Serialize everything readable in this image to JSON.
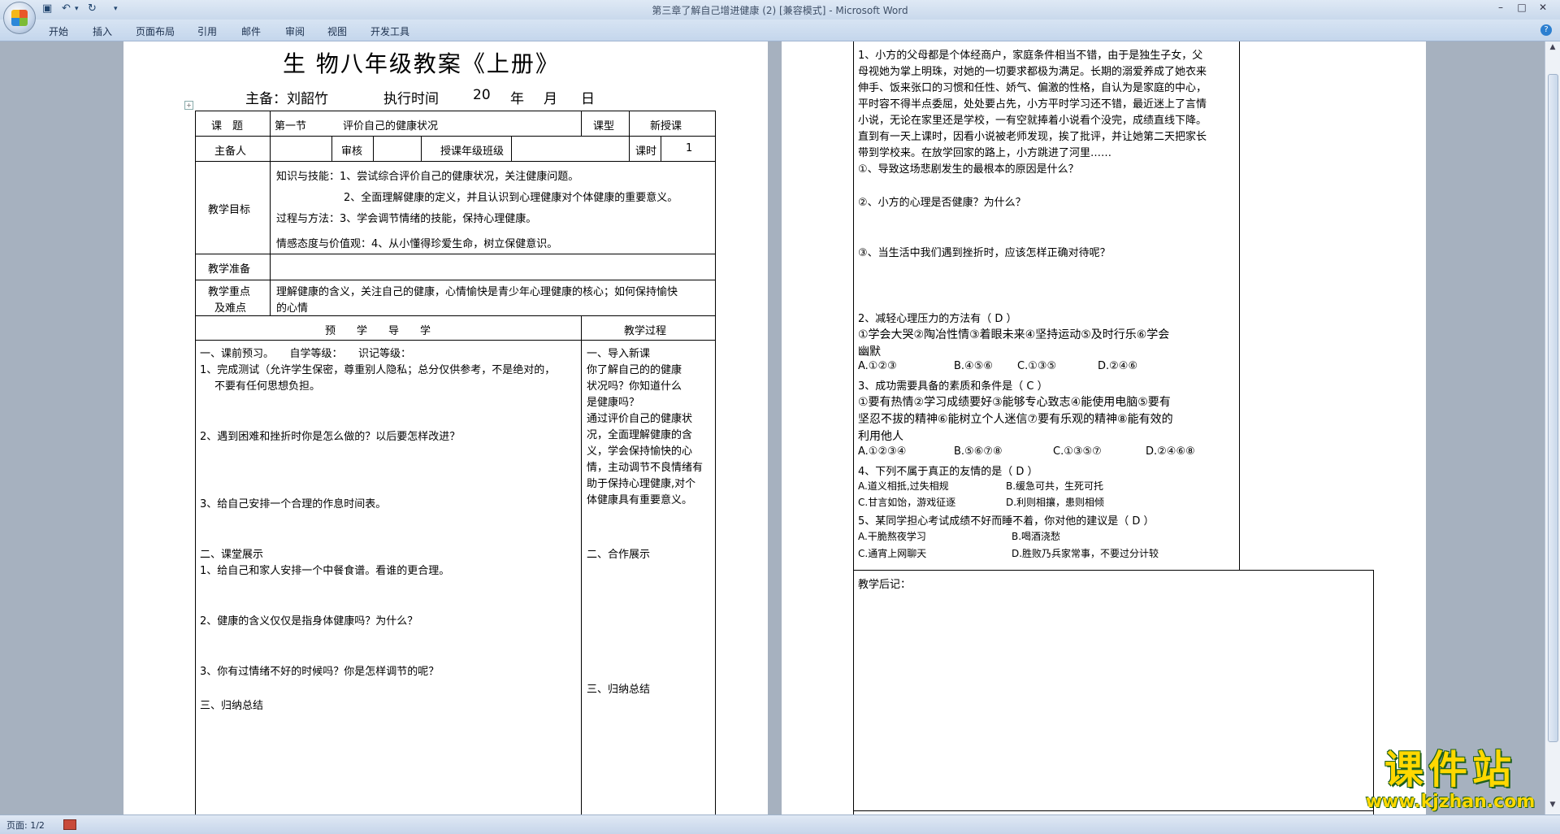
{
  "window": {
    "title": "第三章了解自己增进健康 (2) [兼容模式] - Microsoft Word",
    "controls": [
      "–",
      "□",
      "✕"
    ]
  },
  "ribbon": {
    "tabs": [
      "开始",
      "插入",
      "页面布局",
      "引用",
      "邮件",
      "审阅",
      "视图",
      "开发工具"
    ]
  },
  "page1": {
    "title": "生 物八年级教案《上册》",
    "byline": {
      "author_label": "主备：刘韶竹",
      "time_label": "执行时间",
      "year": "20",
      "nian": "年",
      "yue": "月",
      "ri": "日"
    },
    "table": {
      "topic_label": "课　题",
      "topic_section": "第一节",
      "topic_title": "评价自己的健康状况",
      "type_label": "课型",
      "type_value": "新授课",
      "lead_label": "主备人",
      "review_label": "审核",
      "grade_label": "授课年级班级",
      "hours_label": "课时",
      "hours_value": "1",
      "goals_label": "教学目标",
      "goals": [
        "知识与技能：1、尝试综合评价自己的健康状况，关注健康问题。",
        "2、全面理解健康的定义，并且认识到心理健康对个体健康的重要意义。",
        "过程与方法：3、学会调节情绪的技能，保持心理健康。",
        "情感态度与价值观：4、从小懂得珍爱生命，树立保健意识。"
      ],
      "prep_label": "教学准备",
      "keypoints_label_1": "教学重点",
      "keypoints_label_2": "及难点",
      "keypoints_line_1": "理解健康的含义，关注自己的健康，心情愉快是青少年心理健康的核心；如何保持愉快",
      "keypoints_line_2": "的心情",
      "guide_header": "预　　学　　导　　学",
      "process_header": "教学过程"
    },
    "guide": {
      "preview": "一、课前预习。　　自学等级：　　识记等级：",
      "q1_line1": "1、完成测试（允许学生保密，尊重别人隐私；总分仅供参考，不是绝对的，",
      "q1_line2": "不要有任何思想负担。",
      "q2": "2、遇到困难和挫折时你是怎么做的？以后要怎样改进？",
      "q3": "3、给自己安排一个合理的作息时间表。",
      "display": "二、课堂展示",
      "d1": "1、给自己和家人安排一个中餐食谱。看谁的更合理。",
      "d2": "2、健康的含义仅仅是指身体健康吗？为什么？",
      "d3": "3、你有过情绪不好的时候吗？你是怎样调节的呢？",
      "summary": "三、归纳总结"
    },
    "process": {
      "intro": "一、导入新课",
      "lines": [
        "你了解自己的的健康",
        "状况吗？你知道什么",
        "是健康吗？",
        "通过评价自己的健康状",
        "况，全面理解健康的含",
        "义，学会保持愉快的心",
        "情，主动调节不良情绪有",
        "助于保持心理健康,对个",
        "体健康具有重要意义。"
      ],
      "coop": "二、合作展示",
      "summary": "三、归纳总结"
    }
  },
  "page2": {
    "story": [
      "1、小方的父母都是个体经商户，家庭条件相当不错，由于是独生子女，父",
      "母视她为掌上明珠，对她的一切要求都极为满足。长期的溺爱养成了她衣来",
      "伸手、饭来张口的习惯和任性、娇气、偏激的性格，自认为是家庭的中心，",
      "平时容不得半点委屈，处处要占先，小方平时学习还不错，最近迷上了言情",
      "小说，无论在家里还是学校，一有空就捧着小说看个没完，成绩直线下降。",
      "直到有一天上课时，因看小说被老师发现，挨了批评，并让她第二天把家长",
      "带到学校来。在放学回家的路上，小方跳进了河里……"
    ],
    "q_a": "①、导致这场悲剧发生的最根本的原因是什么？",
    "q_b": "②、小方的心理是否健康？为什么？",
    "q_c": "③、当生活中我们遇到挫折时，应该怎样正确对待呢？",
    "mc2_stem": "2、减轻心理压力的方法有（ D ）",
    "mc2_line1": "①学会大哭②陶冶性情③着眼未来④坚持运动⑤及时行乐⑥学会",
    "mc2_line2": "幽默",
    "mc2_opts": [
      "A.①②③",
      "B.④⑤⑥",
      "C.①③⑤",
      "D.②④⑥"
    ],
    "mc3_stem": "3、成功需要具备的素质和条件是（ C ）",
    "mc3_line1": "①要有热情②学习成绩要好③能够专心致志④能使用电脑⑤要有",
    "mc3_line2": "坚忍不拔的精神⑥能树立个人迷信⑦要有乐观的精神⑧能有效的",
    "mc3_line3": "利用他人",
    "mc3_opts": [
      "A.①②③④",
      "B.⑤⑥⑦⑧",
      "C.①③⑤⑦",
      "D.②④⑥⑧"
    ],
    "mc4_stem": "4、下列不属于真正的友情的是（ D ）",
    "mc4_opts": [
      "A.道义相抵,过失相规",
      "B.缓急可共，生死可托",
      "C.甘言如饴，游戏征逐",
      "D.利则相攘，患则相倾"
    ],
    "mc5_stem": "5、某同学担心考试成绩不好而睡不着，你对他的建议是（ D ）",
    "mc5_opts": [
      "A.干脆熬夜学习",
      "B.喝酒浇愁",
      "C.通宵上网聊天",
      "D.胜败乃兵家常事，不要过分计较"
    ],
    "afterword": "教学后记："
  },
  "status": {
    "page": "页面: 1/2"
  },
  "watermark": {
    "main": "课件站",
    "url": "www.kjzhan.com"
  }
}
